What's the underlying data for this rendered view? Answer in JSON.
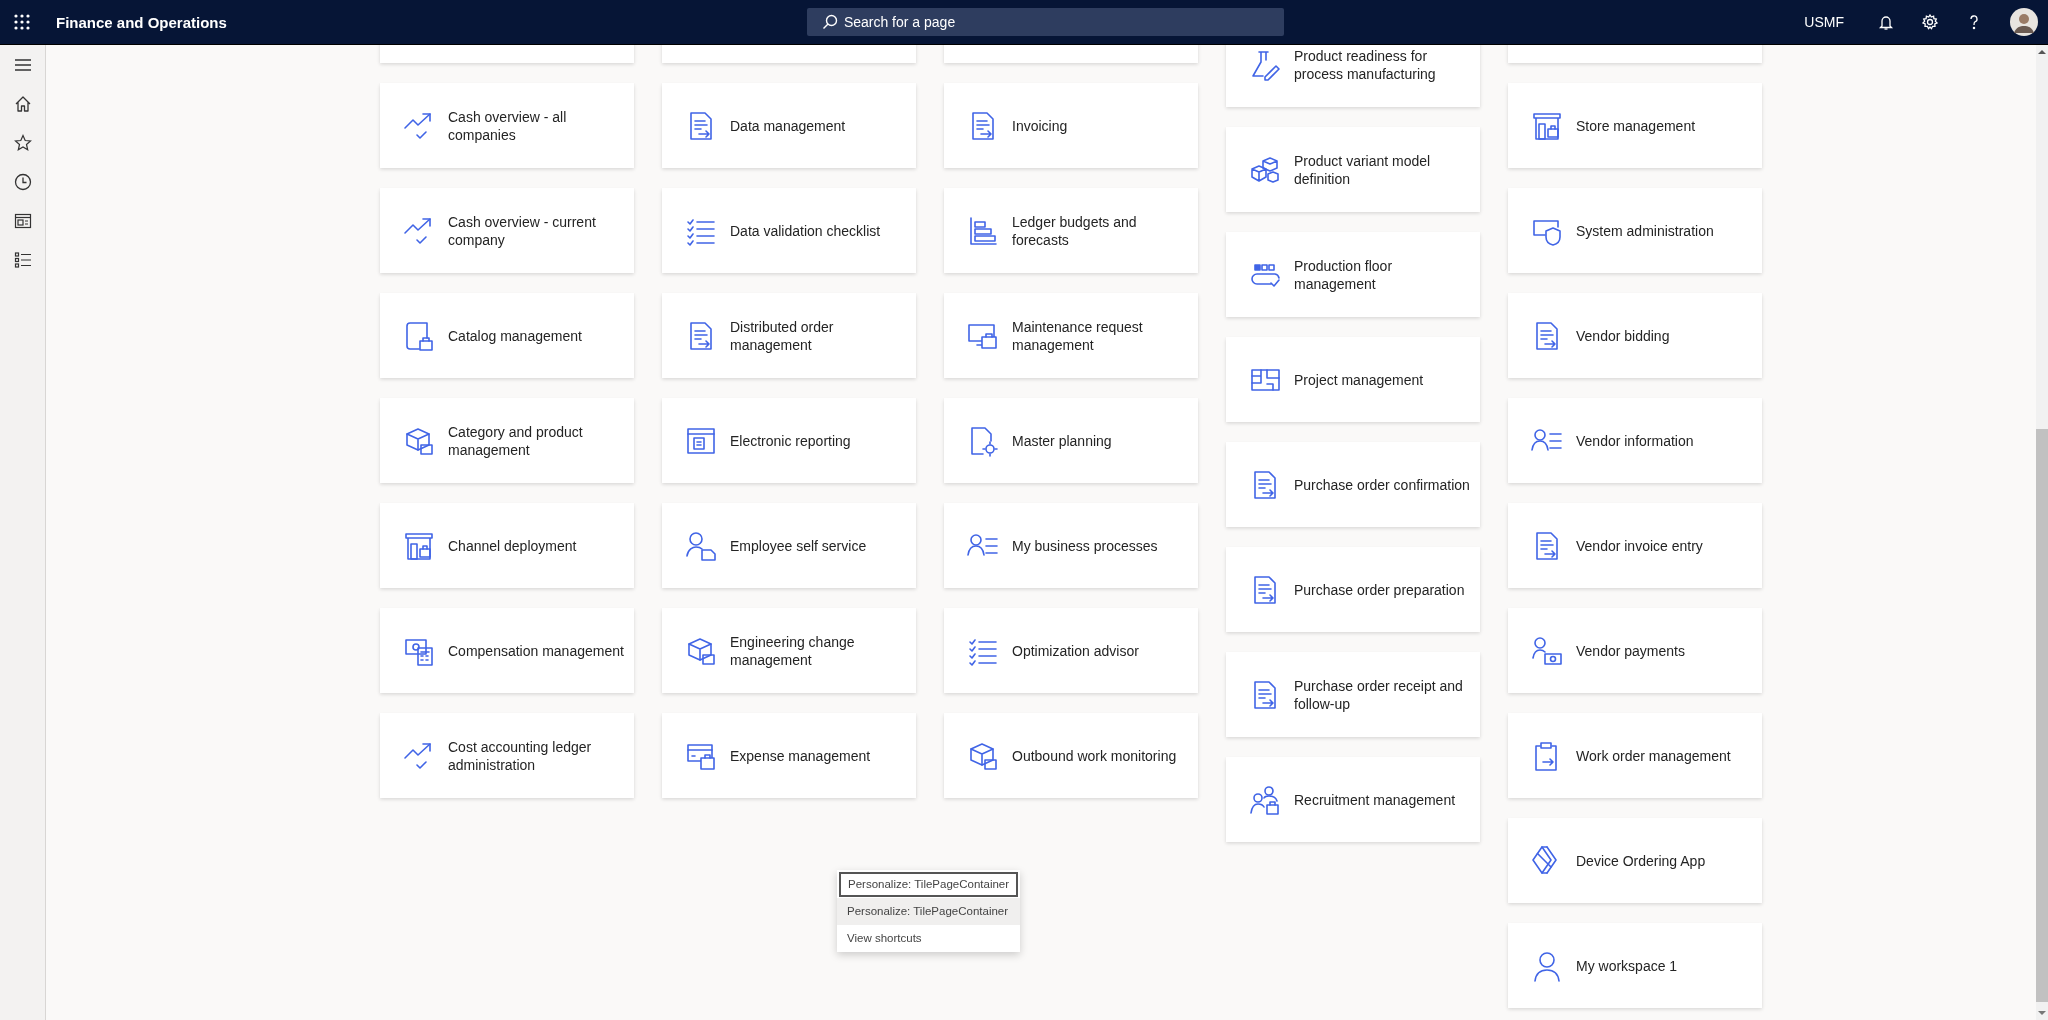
{
  "header": {
    "title": "Finance and Operations",
    "search": {
      "placeholder": "Search for a page"
    },
    "company": "USMF"
  },
  "sidebar": {
    "items": [
      {
        "kind": "menu"
      },
      {
        "kind": "home"
      },
      {
        "kind": "favorites"
      },
      {
        "kind": "recent"
      },
      {
        "kind": "workspaces"
      },
      {
        "kind": "modules"
      }
    ]
  },
  "columns": [
    {
      "tiles": [
        {
          "kind": "cut"
        },
        {
          "kind": "tile",
          "label": "Cash overview - all companies"
        },
        {
          "kind": "tile",
          "label": "Cash overview - current company"
        },
        {
          "kind": "tile",
          "label": "Catalog management"
        },
        {
          "kind": "tile",
          "label": "Category and product management"
        },
        {
          "kind": "tile",
          "label": "Channel deployment"
        },
        {
          "kind": "tile",
          "label": "Compensation management"
        },
        {
          "kind": "tile",
          "label": "Cost accounting ledger administration"
        }
      ]
    },
    {
      "tiles": [
        {
          "kind": "cut"
        },
        {
          "kind": "tile",
          "label": "Data management"
        },
        {
          "kind": "tile",
          "label": "Data validation checklist"
        },
        {
          "kind": "tile",
          "label": "Distributed order management"
        },
        {
          "kind": "tile",
          "label": "Electronic reporting"
        },
        {
          "kind": "tile",
          "label": "Employee self service"
        },
        {
          "kind": "tile",
          "label": "Engineering change management"
        },
        {
          "kind": "tile",
          "label": "Expense management"
        }
      ]
    },
    {
      "tiles": [
        {
          "kind": "cut"
        },
        {
          "kind": "tile",
          "label": "Invoicing"
        },
        {
          "kind": "tile",
          "label": "Ledger budgets and forecasts"
        },
        {
          "kind": "tile",
          "label": "Maintenance request management"
        },
        {
          "kind": "tile",
          "label": "Master planning"
        },
        {
          "kind": "tile",
          "label": "My business processes"
        },
        {
          "kind": "tile",
          "label": "Optimization advisor"
        },
        {
          "kind": "tile",
          "label": "Outbound work monitoring"
        }
      ]
    },
    {
      "tiles": [
        {
          "kind": "tile",
          "label": "Product readiness for process manufacturing"
        },
        {
          "kind": "tile",
          "label": "Product variant model definition"
        },
        {
          "kind": "tile",
          "label": "Production floor management"
        },
        {
          "kind": "tile",
          "label": "Project management"
        },
        {
          "kind": "tile",
          "label": "Purchase order confirmation"
        },
        {
          "kind": "tile",
          "label": "Purchase order preparation"
        },
        {
          "kind": "tile",
          "label": "Purchase order receipt and follow-up"
        },
        {
          "kind": "tile",
          "label": "Recruitment management"
        }
      ]
    },
    {
      "tiles": [
        {
          "kind": "cut"
        },
        {
          "kind": "tile",
          "label": "Store management"
        },
        {
          "kind": "tile",
          "label": "System administration"
        },
        {
          "kind": "tile",
          "label": "Vendor bidding"
        },
        {
          "kind": "tile",
          "label": "Vendor information"
        },
        {
          "kind": "tile",
          "label": "Vendor invoice entry"
        },
        {
          "kind": "tile",
          "label": "Vendor payments"
        },
        {
          "kind": "tile",
          "label": "Work order management"
        },
        {
          "kind": "tile",
          "label": "Device Ordering App"
        },
        {
          "kind": "tile",
          "label": "My workspace 1"
        }
      ]
    }
  ],
  "context_menu": {
    "items": [
      {
        "label": "Personalize: TilePageContainer",
        "focused": true,
        "highlighted": false
      },
      {
        "label": "Personalize: TilePageContainer",
        "focused": false,
        "highlighted": true
      },
      {
        "label": "View shortcuts",
        "focused": false,
        "highlighted": false
      }
    ]
  }
}
